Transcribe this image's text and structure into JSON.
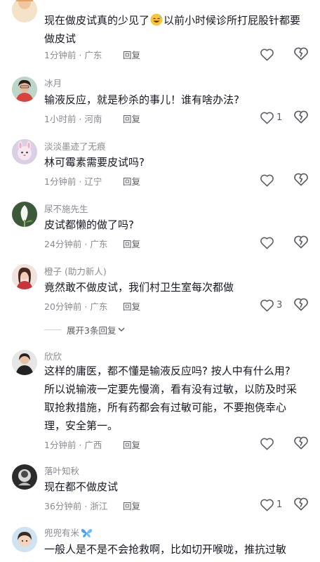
{
  "comments": [
    {
      "username": "",
      "text_lines": [
        "现在做皮试真的少见了",
        "以前小时候诊所打屁股针都要",
        "做皮试"
      ],
      "time": "1分钟前 · 广东",
      "reply_label": "回复",
      "like_count": ""
    },
    {
      "username": "冰月",
      "text_lines": [
        "输液反应，就是秒杀的事儿！谁有啥办法?"
      ],
      "time": "1小时前 · 河南",
      "reply_label": "回复",
      "like_count": "1"
    },
    {
      "username": "淡淡墨迹了无痕",
      "text_lines": [
        "林可霉素需要皮试吗?"
      ],
      "time": "1分钟前 · 辽宁",
      "reply_label": "回复",
      "like_count": ""
    },
    {
      "username": "尿不施先生",
      "text_lines": [
        "皮试都懒的做了吗?"
      ],
      "time": "24分钟前 · 广东",
      "reply_label": "回复",
      "like_count": ""
    },
    {
      "username": "橙子 (助力新人)",
      "text_lines": [
        "竟然敢不做皮试，我们村卫生室每次都做"
      ],
      "time": "20分钟前 · 广东",
      "reply_label": "回复",
      "like_count": "3"
    },
    {
      "username": "欣欣",
      "text_lines": [
        "这样的庸医，都不懂是输液反应吗? 按人中有什么用?",
        "所以说输液一定要先慢滴，看有没有过敏，以防及时采",
        "取抢救措施，所有药都会有过敏可能，不要抱侥幸心",
        "理，安全第一。"
      ],
      "time": "1分钟前 · 广西",
      "reply_label": "回复",
      "like_count": ""
    },
    {
      "username": "落叶知秋",
      "text_lines": [
        "现在都不做皮试"
      ],
      "time": "36分钟前 · 浙江",
      "reply_label": "回复",
      "like_count": "1"
    },
    {
      "username": "兜兜有米",
      "text_lines": [
        "一般人是不是不会抢救啊，比如切开喉咙，推抗过敏"
      ],
      "time": "",
      "reply_label": "",
      "like_count": ""
    }
  ],
  "expand_replies": "展开3条回复",
  "icons": {
    "like": "heart-outline-icon",
    "dislike": "broken-heart-icon",
    "emoji": "grinning-sweat-emoji",
    "butterfly": "blue-butterfly-icon"
  },
  "colors": {
    "text": "#161823",
    "secondary": "#8a8b91",
    "icon": "#5a5b61"
  }
}
